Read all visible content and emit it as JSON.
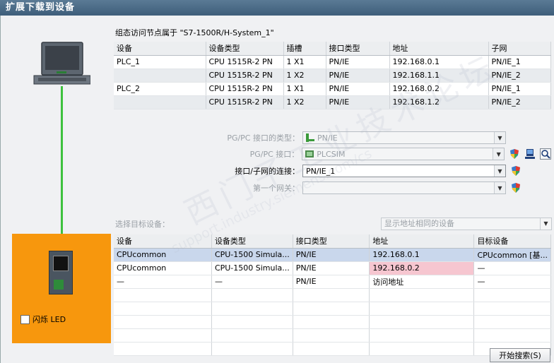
{
  "window": {
    "title": "扩展下载到设备"
  },
  "access_node_title": "组态访问节点属于 \"S7-1500R/H-System_1\"",
  "top_table": {
    "headers": [
      "设备",
      "设备类型",
      "插槽",
      "接口类型",
      "地址",
      "子网"
    ],
    "rows": [
      [
        "PLC_1",
        "CPU 1515R-2 PN",
        "1 X1",
        "PN/IE",
        "192.168.0.1",
        "PN/IE_1"
      ],
      [
        "",
        "CPU 1515R-2 PN",
        "1 X2",
        "PN/IE",
        "192.168.1.1",
        "PN/IE_2"
      ],
      [
        "PLC_2",
        "CPU 1515R-2 PN",
        "1 X1",
        "PN/IE",
        "192.168.0.2",
        "PN/IE_1"
      ],
      [
        "",
        "CPU 1515R-2 PN",
        "1 X2",
        "PN/IE",
        "192.168.1.2",
        "PN/IE_2"
      ]
    ]
  },
  "form": {
    "pgpc_type_label": "PG/PC 接口的类型：",
    "pgpc_type_value": "PN/IE",
    "pgpc_iface_label": "PG/PC 接口：",
    "pgpc_iface_value": "PLCSIM",
    "subnet_label": "接口/子网的连接：",
    "subnet_value": "PN/IE_1",
    "gateway_label": "第一个网关：",
    "gateway_value": ""
  },
  "target": {
    "label": "选择目标设备：",
    "filter_value": "显示地址相同的设备"
  },
  "bottom_table": {
    "headers": [
      "设备",
      "设备类型",
      "接口类型",
      "地址",
      "目标设备"
    ],
    "rows": [
      [
        "CPUcommon",
        "CPU-1500 Simula...",
        "PN/IE",
        "192.168.0.1",
        "CPUcommon [基..."
      ],
      [
        "CPUcommon",
        "CPU-1500 Simula...",
        "PN/IE",
        "192.168.0.2",
        "—"
      ],
      [
        "—",
        "—",
        "PN/IE",
        "访问地址",
        "—"
      ]
    ]
  },
  "flash_led_label": "闪烁 LED",
  "start_search_button": "开始搜索(S)",
  "watermark": {
    "line1": "西门子工业技术论坛",
    "line2": "support.industry.siemens.com/cs"
  },
  "colors": {
    "plc_panel": "#F7970D",
    "connection": "#3EC23E",
    "selected_row": "#C9D7EC",
    "conflict_address": "#F6C6D0"
  }
}
